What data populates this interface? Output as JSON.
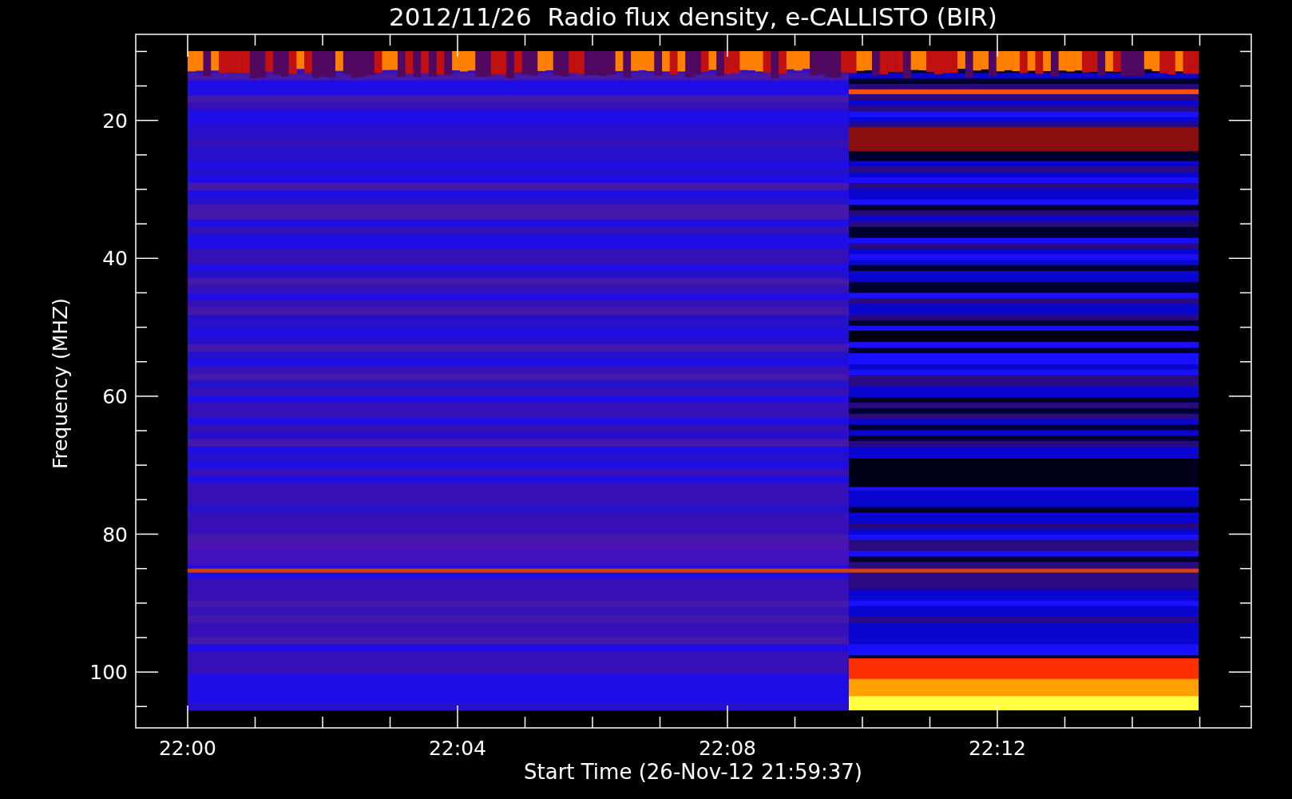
{
  "title": "2012/11/26  Radio flux density, e-CALLISTO (BIR)",
  "y_axis": {
    "label": "Frequency (MHZ)",
    "ticks": [
      "20",
      "40",
      "60",
      "80",
      "100"
    ]
  },
  "x_axis": {
    "label": "Start Time (26-Nov-12 21:59:37)",
    "ticks": [
      "22:00",
      "22:04",
      "22:08",
      "22:12"
    ]
  }
}
